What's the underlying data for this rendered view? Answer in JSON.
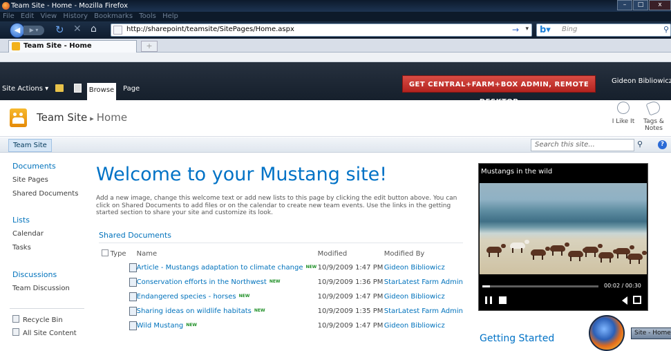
{
  "browser": {
    "window_title": "Team Site - Home - Mozilla Firefox",
    "menu": [
      "File",
      "Edit",
      "View",
      "History",
      "Bookmarks",
      "Tools",
      "Help"
    ],
    "url": "http://sharepoint/teamsite/SitePages/Home.aspx",
    "search_placeholder": "Bing",
    "tab_title": "Team Site - Home",
    "new_tab": "+"
  },
  "ribbon": {
    "site_actions": "Site Actions ▾",
    "tab_browse": "Browse",
    "tab_page": "Page",
    "banner_button": "GET CENTRAL+FARM+BOX ADMIN, REMOTE DESKTOP",
    "user": "Gideon Bibliowicz ▾"
  },
  "header": {
    "site_title": "Team Site",
    "separator": "▸",
    "breadcrumb_page": "Home",
    "like_it": "I Like It",
    "tags_notes": "Tags & Notes"
  },
  "topnav": {
    "home": "Team Site",
    "search_placeholder": "Search this site..."
  },
  "quicklaunch": {
    "documents": "Documents",
    "site_pages": "Site Pages",
    "shared_documents": "Shared Documents",
    "lists": "Lists",
    "calendar": "Calendar",
    "tasks": "Tasks",
    "discussions": "Discussions",
    "team_discussion": "Team Discussion",
    "recycle_bin": "Recycle Bin",
    "all_site_content": "All Site Content"
  },
  "main": {
    "welcome": "Welcome to your Mustang site!",
    "intro": "Add a new image, change this welcome text or add new lists to this page by clicking the edit button above. You can click on Shared Documents to add files or on the calendar to create new team events. Use the links in the getting started section to share your site and customize its look.",
    "shared_docs_title": "Shared Documents",
    "columns": {
      "type": "Type",
      "name": "Name",
      "modified": "Modified",
      "modified_by": "Modified By"
    },
    "new_badge": "NEW",
    "documents": [
      {
        "name": "Article - Mustangs adaptation to climate change",
        "modified": "10/9/2009 1:47 PM",
        "modified_by": "Gideon Bibliowicz"
      },
      {
        "name": "Conservation efforts in the Northwest",
        "modified": "10/9/2009 1:36 PM",
        "modified_by": "StarLatest Farm Admin"
      },
      {
        "name": "Endangered species - horses",
        "modified": "10/9/2009 1:47 PM",
        "modified_by": "Gideon Bibliowicz"
      },
      {
        "name": "Sharing ideas on wildlife habitats",
        "modified": "10/9/2009 1:35 PM",
        "modified_by": "StarLatest Farm Admin"
      },
      {
        "name": "Wild Mustang",
        "modified": "10/9/2009 1:47 PM",
        "modified_by": "Gideon Bibliowicz"
      }
    ]
  },
  "video": {
    "title": "Mustangs in the wild",
    "time": "00:02 / 00:30",
    "progress": 0.067
  },
  "getting_started": "Getting Started",
  "taskbar": {
    "item": "Site - Home -"
  }
}
